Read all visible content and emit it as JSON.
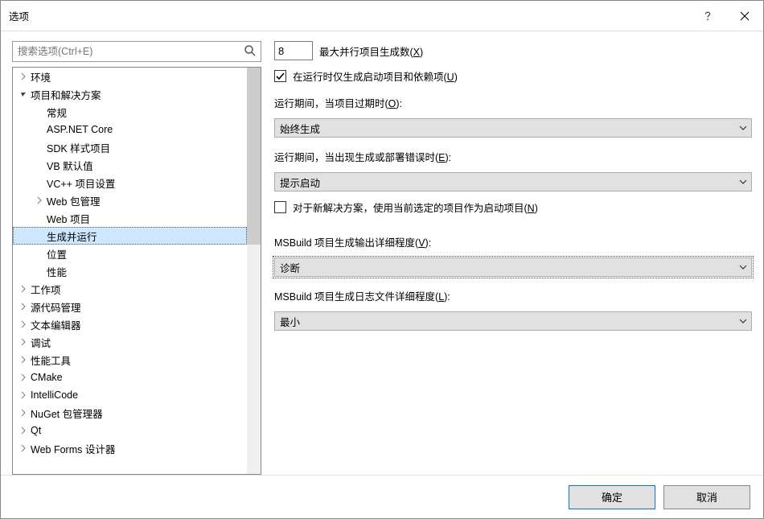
{
  "title": "选项",
  "search": {
    "placeholder": "搜索选项(Ctrl+E)"
  },
  "tree": [
    {
      "level": 1,
      "expand": "closed",
      "label": "环境"
    },
    {
      "level": 1,
      "expand": "open",
      "label": "项目和解决方案"
    },
    {
      "level": 2,
      "expand": "none",
      "label": "常规"
    },
    {
      "level": 2,
      "expand": "none",
      "label": "ASP.NET Core"
    },
    {
      "level": 2,
      "expand": "none",
      "label": "SDK 样式项目"
    },
    {
      "level": 2,
      "expand": "none",
      "label": "VB 默认值"
    },
    {
      "level": 2,
      "expand": "none",
      "label": "VC++ 项目设置"
    },
    {
      "level": 2,
      "expand": "closed",
      "label": "Web 包管理"
    },
    {
      "level": 2,
      "expand": "none",
      "label": "Web 项目"
    },
    {
      "level": 2,
      "expand": "none",
      "label": "生成并运行",
      "selected": true,
      "current": true
    },
    {
      "level": 2,
      "expand": "none",
      "label": "位置"
    },
    {
      "level": 2,
      "expand": "none",
      "label": "性能"
    },
    {
      "level": 1,
      "expand": "closed",
      "label": "工作项"
    },
    {
      "level": 1,
      "expand": "closed",
      "label": "源代码管理"
    },
    {
      "level": 1,
      "expand": "closed",
      "label": "文本编辑器"
    },
    {
      "level": 1,
      "expand": "closed",
      "label": "调试"
    },
    {
      "level": 1,
      "expand": "closed",
      "label": "性能工具"
    },
    {
      "level": 1,
      "expand": "closed",
      "label": "CMake"
    },
    {
      "level": 1,
      "expand": "closed",
      "label": "IntelliCode"
    },
    {
      "level": 1,
      "expand": "closed",
      "label": "NuGet 包管理器"
    },
    {
      "level": 1,
      "expand": "closed",
      "label": "Qt"
    },
    {
      "level": 1,
      "expand": "closed",
      "label": "Web Forms 设计器"
    }
  ],
  "form": {
    "parallel_value": "8",
    "parallel_label_pre": "最大并行项目生成数(",
    "parallel_label_u": "X",
    "parallel_label_post": ")",
    "chk1_checked": true,
    "chk1_pre": "在运行时仅生成启动项目和依赖项(",
    "chk1_u": "U",
    "chk1_post": ")",
    "outofdate_label_pre": "运行期间，当项目过期时(",
    "outofdate_label_u": "O",
    "outofdate_label_post": "):",
    "outofdate_value": "始终生成",
    "onerror_label_pre": "运行期间，当出现生成或部署错误时(",
    "onerror_label_u": "E",
    "onerror_label_post": "):",
    "onerror_value": "提示启动",
    "chk2_checked": false,
    "chk2_pre": "对于新解决方案，使用当前选定的项目作为启动项目(",
    "chk2_u": "N",
    "chk2_post": ")",
    "verbosity_label_pre": "MSBuild 项目生成输出详细程度(",
    "verbosity_label_u": "V",
    "verbosity_label_post": "):",
    "verbosity_value": "诊断",
    "logverbosity_label_pre": "MSBuild 项目生成日志文件详细程度(",
    "logverbosity_label_u": "L",
    "logverbosity_label_post": "):",
    "logverbosity_value": "最小"
  },
  "buttons": {
    "ok": "确定",
    "cancel": "取消"
  }
}
